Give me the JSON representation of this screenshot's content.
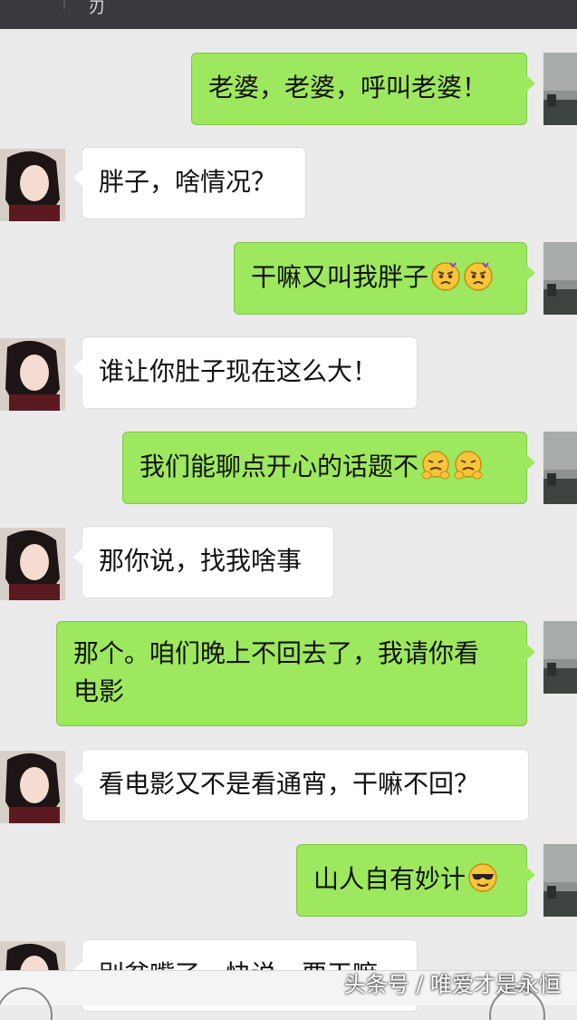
{
  "header": {
    "title_fragment": "刃"
  },
  "messages": [
    {
      "side": "right",
      "text": "老婆，老婆，呼叫老婆！",
      "emoji": []
    },
    {
      "side": "left",
      "text": "胖子，啥情况？",
      "emoji": []
    },
    {
      "side": "right",
      "text": "干嘛又叫我胖子",
      "emoji": [
        "angry-face-icon",
        "angry-face-icon"
      ]
    },
    {
      "side": "left",
      "text": "谁让你肚子现在这么大！",
      "emoji": []
    },
    {
      "side": "right",
      "text": "我们能聊点开心的话题不",
      "emoji": [
        "shy-face-icon",
        "shy-face-icon"
      ]
    },
    {
      "side": "left",
      "text": "那你说，找我啥事",
      "emoji": []
    },
    {
      "side": "right",
      "text": "那个。咱们晚上不回去了，我请你看电影",
      "emoji": []
    },
    {
      "side": "left",
      "text": "看电影又不是看通宵，干嘛不回？",
      "emoji": []
    },
    {
      "side": "right",
      "text": "山人自有妙计",
      "emoji": [
        "cool-sunglasses-icon"
      ]
    },
    {
      "side": "left",
      "text": "别贫嘴了，快说，要干嘛",
      "emoji": []
    }
  ],
  "watermark": "头条号 / 唯爱才是永恒",
  "colors": {
    "outgoing_bubble": "#9de85e",
    "incoming_bubble": "#ffffff",
    "chat_background": "#ebebeb",
    "top_bar": "#393a3e"
  }
}
